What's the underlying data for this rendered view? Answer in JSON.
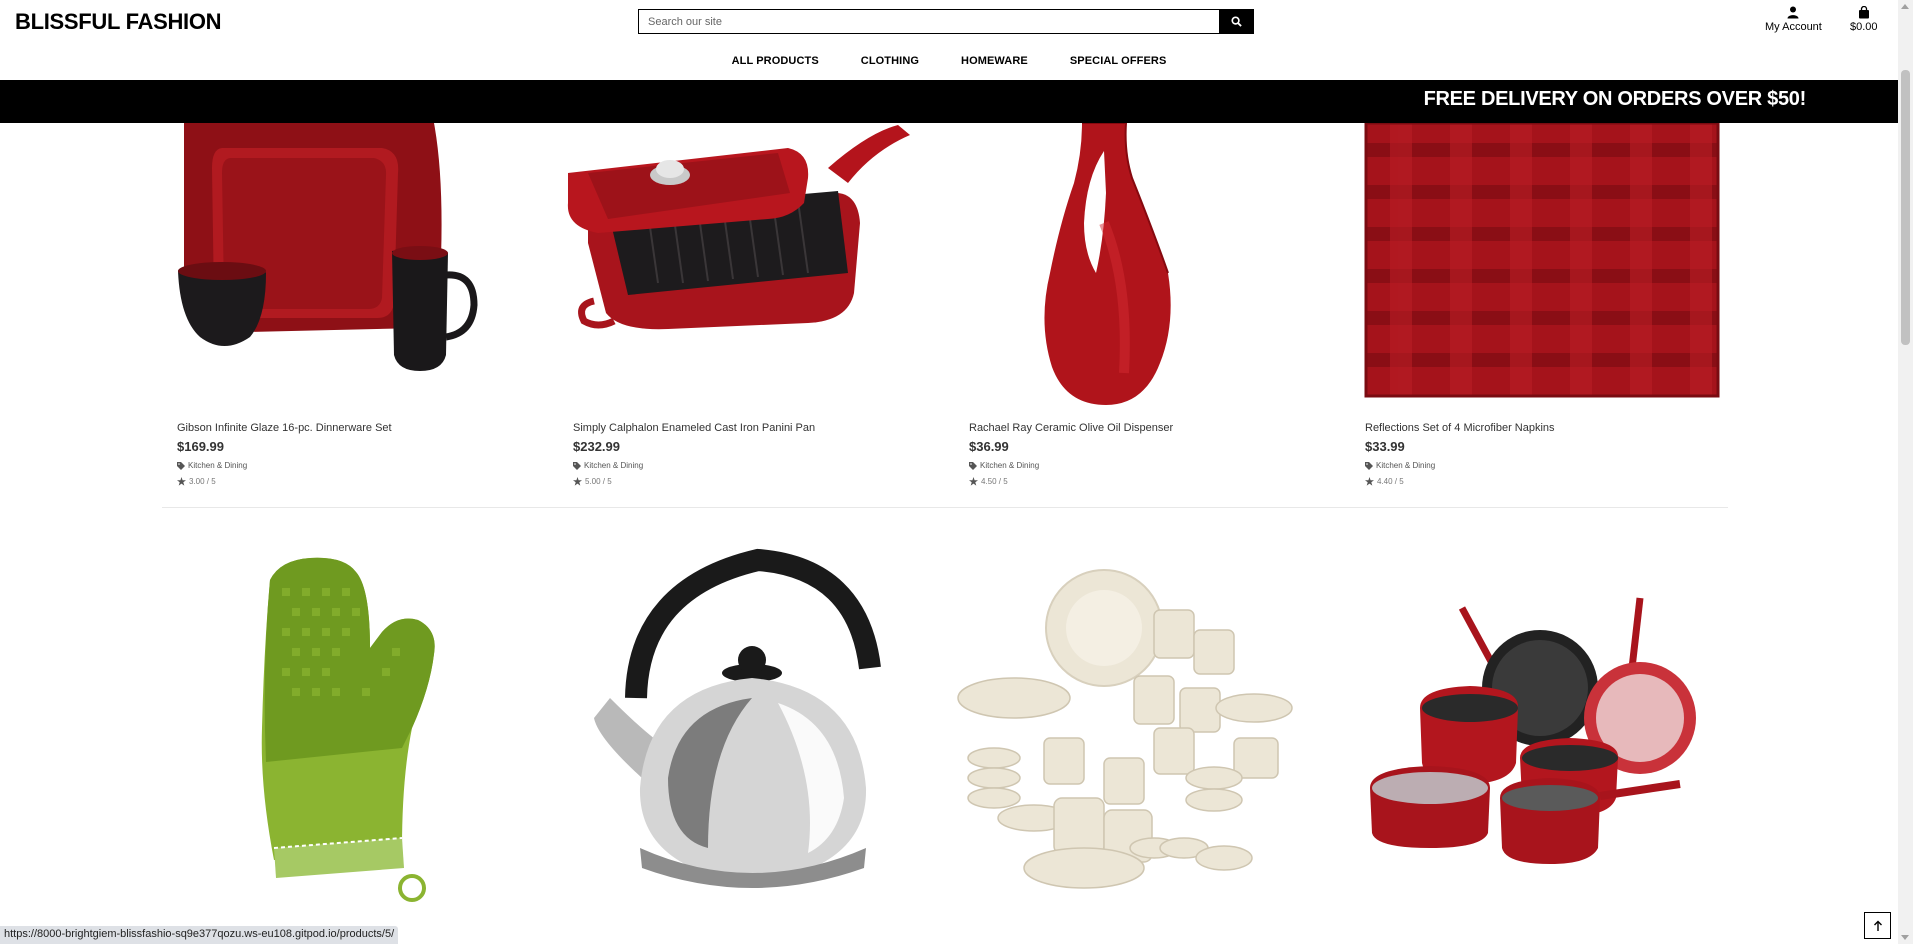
{
  "header": {
    "brand": "BLISSFUL FASHION",
    "search_placeholder": "Search our site",
    "account_label": "My Account",
    "cart_total": "$0.00"
  },
  "nav": {
    "items": [
      "ALL PRODUCTS",
      "CLOTHING",
      "HOMEWARE",
      "SPECIAL OFFERS"
    ]
  },
  "banner": {
    "text": "FREE DELIVERY ON ORDERS OVER $50!"
  },
  "products": [
    {
      "name": "Gibson Infinite Glaze 16-pc. Dinnerware Set",
      "price": "$169.99",
      "category": "Kitchen & Dining",
      "rating": "3.00 / 5"
    },
    {
      "name": "Simply Calphalon Enameled Cast Iron Panini Pan",
      "price": "$232.99",
      "category": "Kitchen & Dining",
      "rating": "5.00 / 5"
    },
    {
      "name": "Rachael Ray Ceramic Olive Oil Dispenser",
      "price": "$36.99",
      "category": "Kitchen & Dining",
      "rating": "4.50 / 5"
    },
    {
      "name": "Reflections Set of 4 Microfiber Napkins",
      "price": "$33.99",
      "category": "Kitchen & Dining",
      "rating": "4.40 / 5"
    }
  ],
  "status_bar": {
    "url": "https://8000-brightgiem-blissfashio-sq9e377qozu.ws-eu108.gitpod.io/products/5/"
  },
  "colors": {
    "banner_bg": "#000000",
    "banner_text": "#ffffff",
    "product_red": "#a8141c",
    "mitt_green": "#8bb431"
  }
}
